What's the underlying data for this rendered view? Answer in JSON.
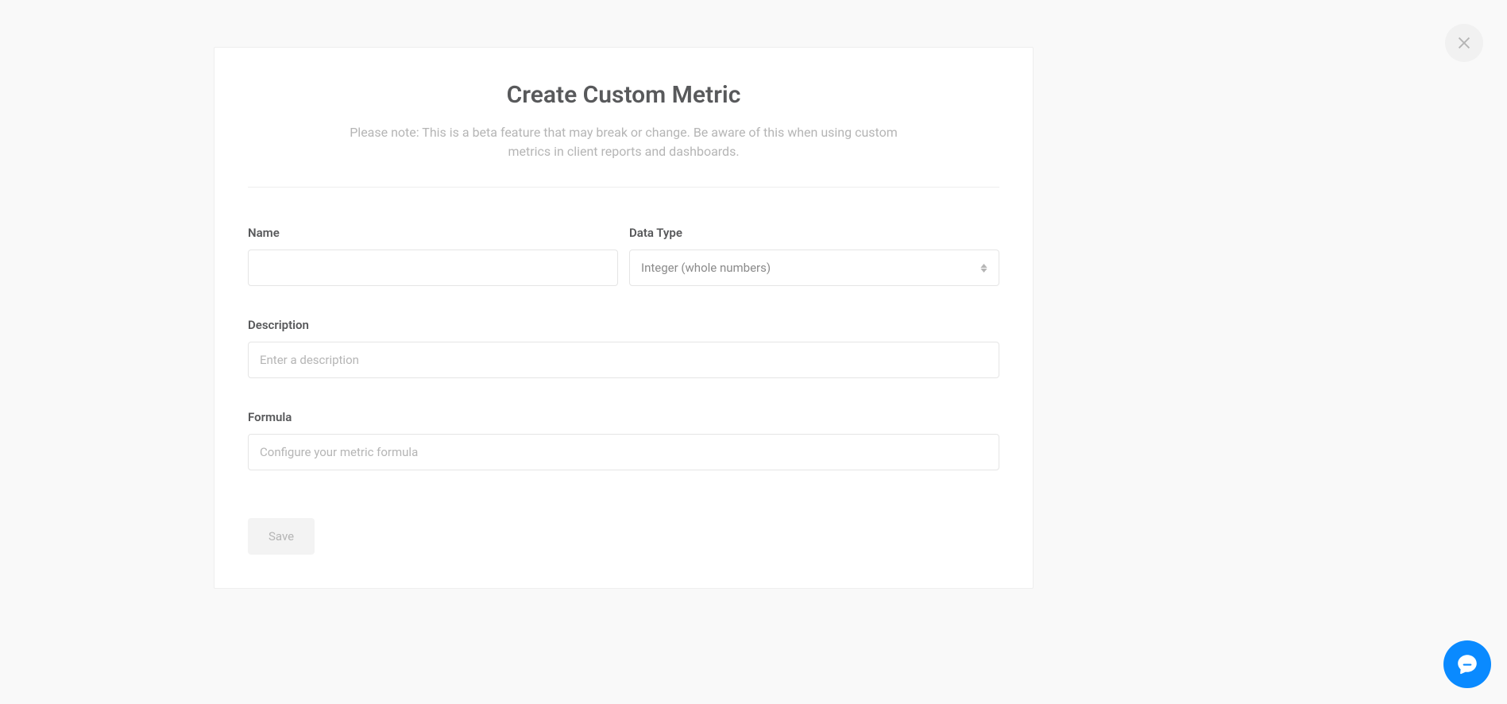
{
  "modal": {
    "title": "Create Custom Metric",
    "note": "Please note: This is a beta feature that may break or change. Be aware of this when using custom metrics in client reports and dashboards."
  },
  "form": {
    "name": {
      "label": "Name",
      "value": ""
    },
    "dataType": {
      "label": "Data Type",
      "selected": "Integer (whole numbers)"
    },
    "description": {
      "label": "Description",
      "placeholder": "Enter a description",
      "value": ""
    },
    "formula": {
      "label": "Formula",
      "placeholder": "Configure your metric formula",
      "value": ""
    },
    "saveButton": "Save"
  }
}
